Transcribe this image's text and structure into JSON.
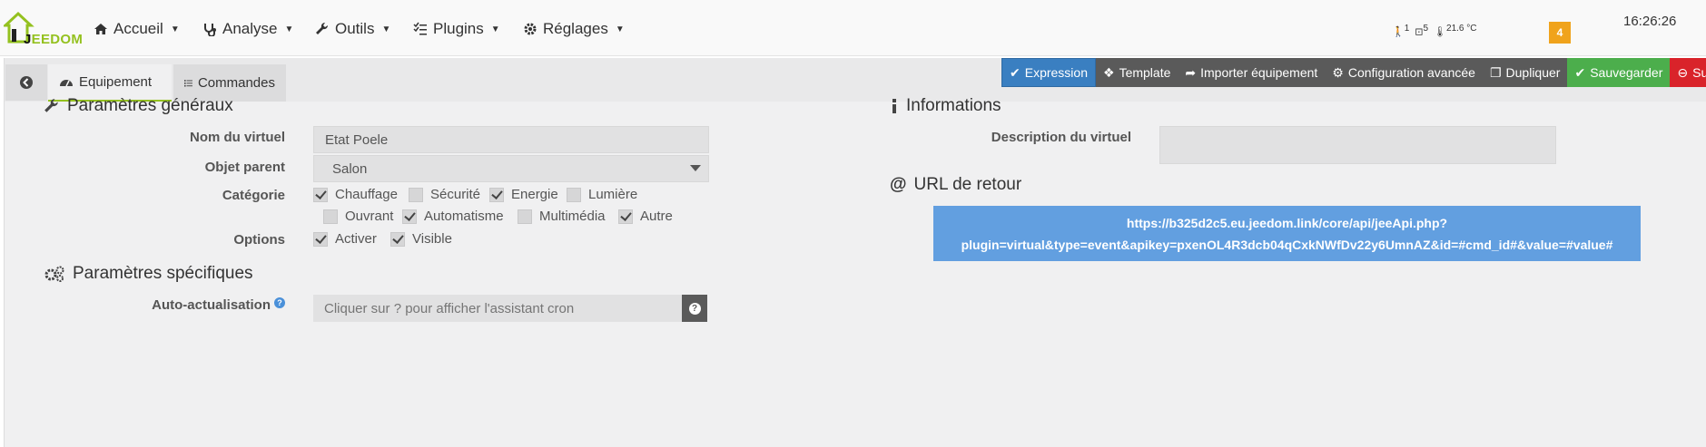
{
  "app": {
    "logo_text_first": "J",
    "logo_text_rest": "EEDOM"
  },
  "navbar": {
    "items": [
      {
        "label": "Accueil",
        "icon": "home-icon"
      },
      {
        "label": "Analyse",
        "icon": "stethoscope-icon"
      },
      {
        "label": "Outils",
        "icon": "wrench-icon"
      },
      {
        "label": "Plugins",
        "icon": "tasks-icon"
      },
      {
        "label": "Réglages",
        "icon": "cog-icon"
      }
    ],
    "status": {
      "motion_count": "1",
      "window_count": "5",
      "temperature": "21.6 °C"
    },
    "notification_count": "4",
    "clock": "16:26:26"
  },
  "tabs": {
    "active": "Equipement",
    "commands": "Commandes"
  },
  "actions": {
    "expression": "Expression",
    "template": "Template",
    "import": "Importer équipement",
    "advanced": "Configuration avancée",
    "duplicate": "Dupliquer",
    "save": "Sauvegarder",
    "delete": "Supprim"
  },
  "general": {
    "title": "Paramètres généraux",
    "name_label": "Nom du virtuel",
    "name_value": "Etat Poele",
    "parent_label": "Objet parent",
    "parent_value": "Salon",
    "category_label": "Catégorie",
    "categories": [
      {
        "label": "Chauffage",
        "checked": true
      },
      {
        "label": "Sécurité",
        "checked": false
      },
      {
        "label": "Energie",
        "checked": true
      },
      {
        "label": "Lumière",
        "checked": false
      },
      {
        "label": "Ouvrant",
        "checked": false
      },
      {
        "label": "Automatisme",
        "checked": true
      },
      {
        "label": "Multimédia",
        "checked": false
      },
      {
        "label": "Autre",
        "checked": true
      }
    ],
    "options_label": "Options",
    "options": [
      {
        "label": "Activer",
        "checked": true
      },
      {
        "label": "Visible",
        "checked": true
      }
    ]
  },
  "specific": {
    "title": "Paramètres spécifiques",
    "auto_label": "Auto-actualisation",
    "auto_placeholder": "Cliquer sur ? pour afficher l'assistant cron"
  },
  "informations": {
    "title": "Informations",
    "description_label": "Description du virtuel"
  },
  "return_url": {
    "title": "URL de retour",
    "line1": "https://b325d2c5.eu.jeedom.link/core/api/jeeApi.php?",
    "line2": "plugin=virtual&type=event&apikey=pxenOL4R3dcb04qCxkNWfDv22y6UmnAZ&id=#cmd_id#&value=#value#"
  },
  "colors": {
    "accent_green": "#94c11f",
    "primary_blue": "#3a7fc1",
    "url_blue": "#629fe0",
    "save_green": "#4cae4c",
    "delete_red": "#d9232a",
    "badge_orange": "#f0a31c"
  }
}
